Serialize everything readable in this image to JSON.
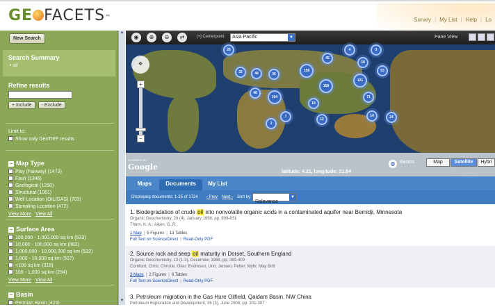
{
  "header": {
    "logo_text_1": "GE",
    "logo_text_2": "FACETS",
    "links": [
      "Survey",
      "My List",
      "Help",
      "Lo"
    ]
  },
  "sidebar": {
    "new_search": "New Search",
    "summary_title": "Search Summary",
    "summary_term": "• oil",
    "refine_title": "Refine results",
    "refine_input_value": "",
    "include_label": "Include",
    "exclude_label": "Exclude",
    "limit_to": "Limit to:",
    "geotiff_label": "Show only GeoTIFF results",
    "map_type": {
      "title": "Map Type",
      "items": [
        "Play (Fairway) (1473)",
        "Fault (1346)",
        "Geological (1250)",
        "Structural (1061)",
        "Well Location (OIL/GAS) (703)",
        "Sampling Location (472)"
      ],
      "view_more": "View More",
      "view_all": "View All"
    },
    "surface_area": {
      "title": "Surface Area",
      "items": [
        "100,000 - 1,000,000 sq km (933)",
        "10,000 - 100,000 sq km (862)",
        "1,000,000 - 10,000,000 sq km (532)",
        "1,000 - 10,000 sq km (507)",
        "<100 sq km (318)",
        "100 - 1,000 sq km (294)"
      ],
      "view_more": "View More",
      "view_all": "View All"
    },
    "basin": {
      "title": "Basin",
      "items": [
        "Permian Basin (423)"
      ]
    }
  },
  "map": {
    "centerpoint_label": "[+] Centerpoint",
    "centerpoint_value": "Asia Pacific",
    "pane_view": "Pane View",
    "basins_label": "Basins",
    "map_types": [
      "Map",
      "Satellite",
      "Hybri"
    ],
    "active_map_type": "Satellite",
    "latlon": "latitude: 4.21, longitude: 31.64",
    "powered_by": "POWERED BY",
    "google": "Google",
    "copyright": "©2010 - Terms of Use",
    "clusters": [
      "26",
      "4",
      "3",
      "32",
      "48",
      "36",
      "158",
      "45",
      "18",
      "53",
      "48",
      "164",
      "158",
      "121",
      "71",
      "19",
      "7",
      "12",
      "14",
      "24",
      "3"
    ]
  },
  "tabs": [
    "Maps",
    "Documents",
    "My List"
  ],
  "active_tab": "Documents",
  "resultsbar": {
    "displaying": "Displaying documents: 1-25 of 1724",
    "prev": "‹ Prev",
    "next": "Next ›",
    "sort_by": "Sort by:",
    "sort_value": "Relevance"
  },
  "results": [
    {
      "number": "1.",
      "title_pre": "Biodegradation of crude ",
      "title_hl": "oil",
      "title_post": " into nonvolatile organic acids in a contaminated aquifer near Bemidji, Minnesota",
      "source": "Organic Geochemistry, 29 (4), January 1998, pp. 909-931",
      "authors": "Thorn, K. A.; Aiken, G. R.",
      "maps": "1 Map",
      "figures": "5 Figures",
      "tables": "13 Tables",
      "full_text": "Full Text on ScienceDirect",
      "pdf": "Read-Only PDF"
    },
    {
      "number": "2.",
      "title_pre": "Source rock and seep ",
      "title_hl": "oil",
      "title_post": " maturity in Dorset, Southern England",
      "source": "Organic Geochemistry, 13 (1-3), December 1988, pp. 399-409",
      "authors": "Cornford, Chris; Christie, Olav; Endresen, Unn; Jensen, Petter; Myhr, May Britt",
      "maps": "3 Maps",
      "figures": "2 Figures",
      "tables": "8 Tables",
      "full_text": "Full Text on ScienceDirect",
      "pdf": "Read-Only PDF"
    },
    {
      "number": "3.",
      "title_pre": "Petroleum migration in the Gas Hure Oilfield, Qaidam Basin, NW China",
      "title_hl": "",
      "title_post": "",
      "source": "Petroleum Exploration and Development, 35 (3), June 2008, pp. 301-307",
      "authors": "",
      "maps": "",
      "figures": "",
      "tables": "",
      "full_text": "",
      "pdf": ""
    }
  ]
}
